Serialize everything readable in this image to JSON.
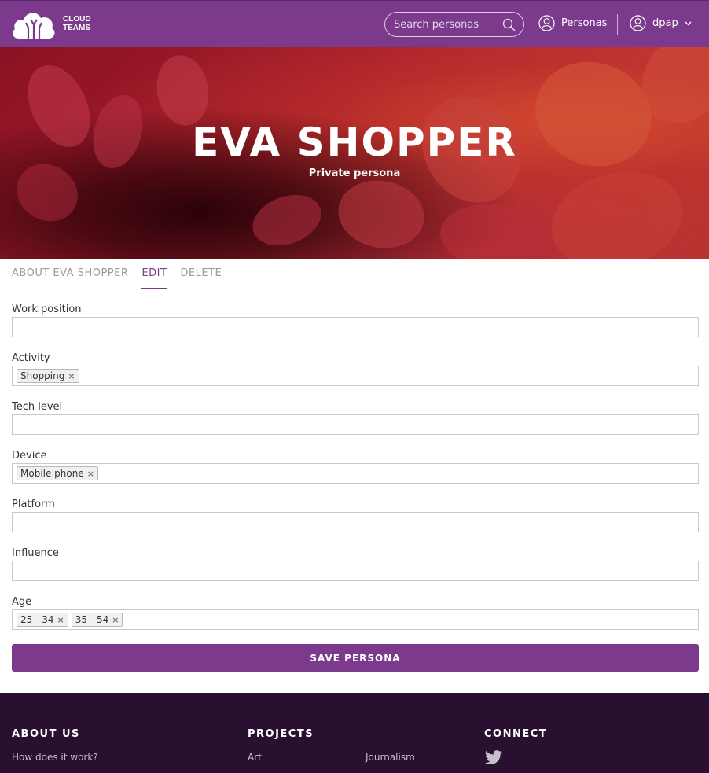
{
  "header": {
    "logo_line1": "CLOUD",
    "logo_line2": "TEAMS",
    "search_placeholder": "Search personas",
    "nav_personas": "Personas",
    "nav_user": "dpap"
  },
  "hero": {
    "title": "EVA SHOPPER",
    "subtitle": "Private persona"
  },
  "tabs": [
    {
      "label": "ABOUT EVA SHOPPER",
      "active": false
    },
    {
      "label": "EDIT",
      "active": true
    },
    {
      "label": "DELETE",
      "active": false
    }
  ],
  "form": {
    "work_position": {
      "label": "Work position",
      "value": ""
    },
    "activity": {
      "label": "Activity",
      "tags": [
        "Shopping"
      ]
    },
    "tech_level": {
      "label": "Tech level",
      "value": ""
    },
    "device": {
      "label": "Device",
      "tags": [
        "Mobile phone"
      ]
    },
    "platform": {
      "label": "Platform",
      "value": ""
    },
    "influence": {
      "label": "Influence",
      "value": ""
    },
    "age": {
      "label": "Age",
      "tags": [
        "25 - 34",
        "35 - 54"
      ]
    },
    "tag_remove": "×",
    "save_label": "SAVE PERSONA"
  },
  "footer": {
    "about_heading": "ABOUT US",
    "about_link": "How does it work?",
    "projects_heading": "PROJECTS",
    "project_link_1": "Art",
    "project_link_2": "Journalism",
    "connect_heading": "CONNECT"
  },
  "colors": {
    "brand": "#7b3a8c",
    "footer": "#2a1030"
  }
}
